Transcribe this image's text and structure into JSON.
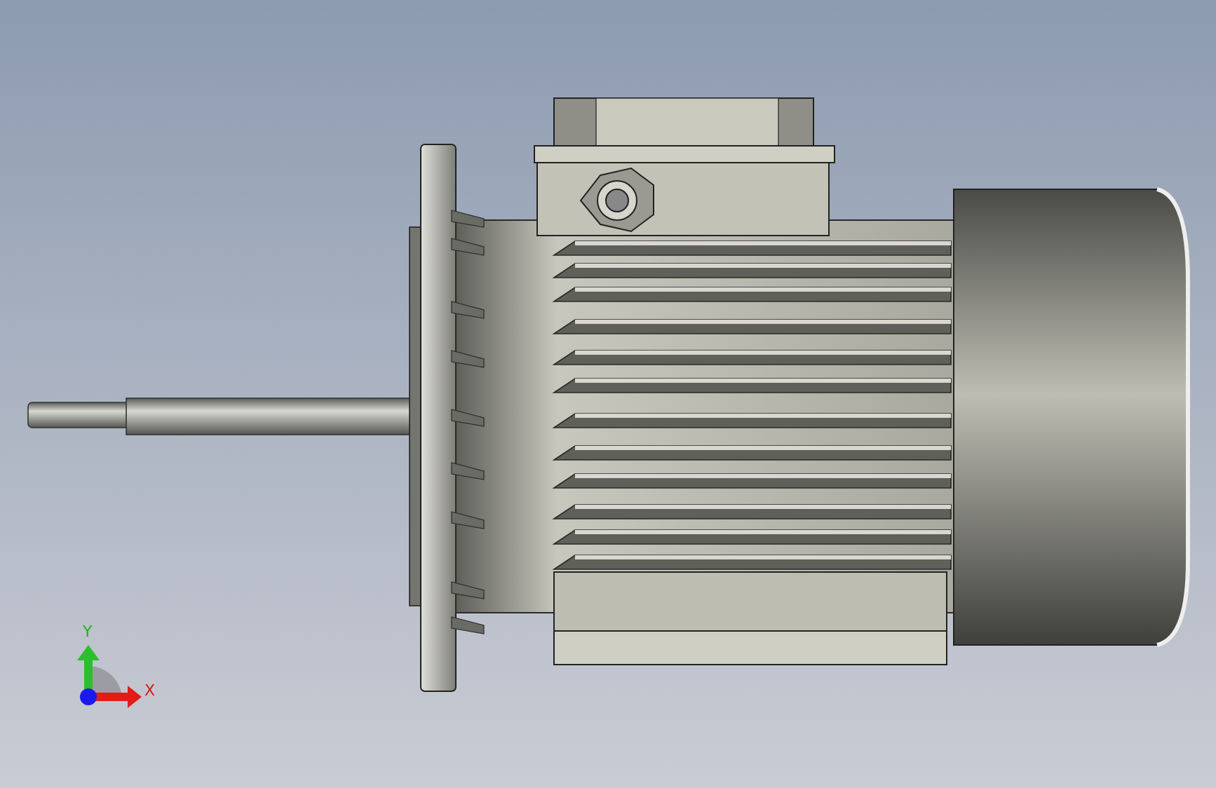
{
  "viewport": {
    "model": {
      "kind": "motor"
    },
    "triad": {
      "axes": [
        {
          "kind": "y",
          "label": "Y"
        },
        {
          "kind": "x",
          "label": "X"
        }
      ]
    }
  }
}
